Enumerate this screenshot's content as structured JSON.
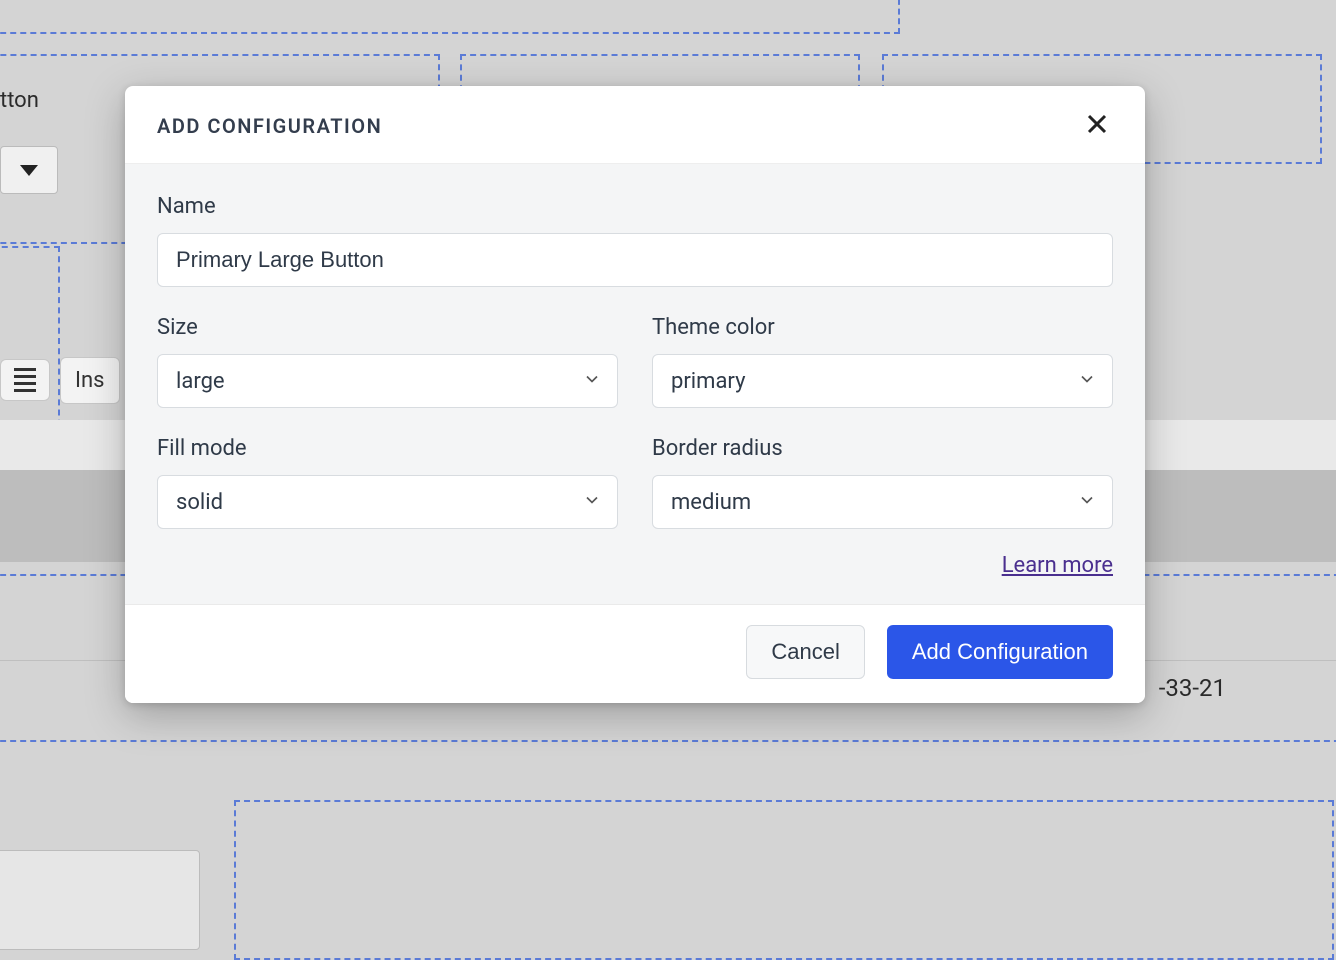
{
  "background": {
    "partial_label": "tton",
    "toolbar_partial": "Ins",
    "timestamp_partial": "-33-21"
  },
  "modal": {
    "title": "Add Configuration",
    "fields": {
      "name": {
        "label": "Name",
        "value": "Primary Large Button"
      },
      "size": {
        "label": "Size",
        "value": "large"
      },
      "theme_color": {
        "label": "Theme color",
        "value": "primary"
      },
      "fill_mode": {
        "label": "Fill mode",
        "value": "solid"
      },
      "border_radius": {
        "label": "Border radius",
        "value": "medium"
      }
    },
    "learn_more": "Learn more",
    "footer": {
      "cancel": "Cancel",
      "submit": "Add Configuration"
    }
  }
}
